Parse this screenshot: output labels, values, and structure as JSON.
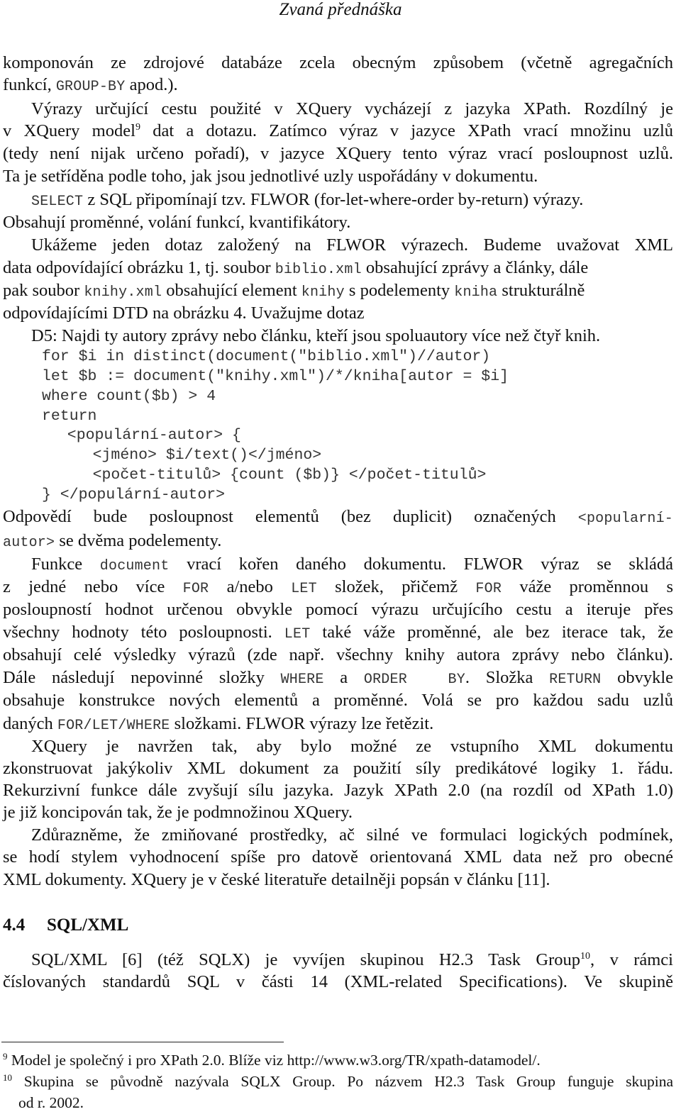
{
  "header": {
    "running_title": "Zvaná přednáška"
  },
  "paragraphs": {
    "p1": {
      "l1": "komponován ze zdrojové databáze zcela obecným způsobem (včetně agregačních",
      "l2_a": "funkcí,",
      "l2_code": "GROUP-BY",
      "l2_b": "apod.)."
    },
    "p2": {
      "l1": "Výrazy určující cestu použité v XQuery  vycházejí z jazyka XPath. Rozdílný je",
      "l2_a": "v XQuery model",
      "l2_fn": "9",
      "l2_b": " dat a dotazu. Zatímco výraz v jazyce XPath vrací množinu uzlů",
      "l3": "(tedy není nijak určeno pořadí), v jazyce XQuery tento výraz vrací posloupnost uzlů.",
      "l4": "Ta je setříděna podle toho, jak jsou jednotlivé uzly uspořádány v dokumentu."
    },
    "p3": {
      "l1_code": "SELECT",
      "l1_b": " z SQL připomínají tzv. FLWOR (for-let-where-order by-return) výrazy.",
      "l2": "Obsahují proměnné, volání funkcí, kvantifikátory."
    },
    "p4": {
      "l1": "Ukážeme jeden dotaz založený na FLWOR výrazech. Budeme uvažovat XML",
      "l2_a": "data odpovídající obrázku 1, tj. soubor ",
      "l2_code": "biblio.xml",
      "l2_b": " obsahující zprávy a články, dále",
      "l3_a": "pak soubor ",
      "l3_code1": "knihy.xml",
      "l3_b": " obsahující element ",
      "l3_code2": "knihy",
      "l3_c": " s podelementy ",
      "l3_code3": "kniha",
      "l3_d": " strukturálně",
      "l4": "odpovídajícími DTD na obrázku 4. Uvažujme dotaz"
    },
    "query_d5": "D5: Najdi ty autory zprávy nebo článku, kteří jsou spoluautory více než čtyř knih.",
    "code_lines": [
      "for $i in distinct(document(\"biblio.xml\")//autor)",
      "let $b := document(\"knihy.xml\")/*/kniha[autor = $i]",
      "where count($b) > 4",
      "return",
      "  <populární-autor> {",
      "    <jméno> $i/text()</jméno>",
      "    <počet-titulů> {count ($b)} </počet-titulů>",
      "} </populární-autor>"
    ],
    "p5": {
      "l1_a": "Odpovědí bude posloupnost elementů (bez duplicit) označených ",
      "l1_code": "<popularní-",
      "l2_code": "autor>",
      "l2_b": " se dvěma podelementy."
    },
    "p6": {
      "l1_a": "Funkce ",
      "l1_code": "document",
      "l1_b": " vrací kořen daného dokumentu.  FLWOR výraz se skládá",
      "l2_a": "z jedné nebo více ",
      "l2_code1": "FOR",
      "l2_b": " a/nebo ",
      "l2_code2": "LET",
      "l2_c": " složek, přičemž ",
      "l2_code3": "FOR",
      "l2_d": " váže proměnnou s",
      "l3": "posloupností hodnot určenou obvykle pomocí výrazu určujícího cestu a iteruje přes",
      "l4_a": "všechny hodnoty této posloupnosti. ",
      "l4_code": "LET",
      "l4_b": " také váže proměnné, ale bez iterace tak, že",
      "l5": "obsahují celé výsledky výrazů (zde např. všechny knihy autora zprávy nebo článku).",
      "l6_a": "Dále následují nepovinné složky ",
      "l6_code1": "WHERE",
      "l6_b": " a ",
      "l6_code2": "ORDER  BY",
      "l6_c": ". Složka ",
      "l6_code3": "RETURN",
      "l6_d": " obvykle",
      "l7": "obsahuje konstrukce nových elementů a proměnné. Volá se pro každou sadu uzlů",
      "l8_a": "daných ",
      "l8_code": "FOR/LET/WHERE",
      "l8_b": " složkami. FLWOR výrazy lze řetězit."
    },
    "p7": {
      "l1": "XQuery je navržen tak, aby bylo možné ze vstupního XML dokumentu",
      "l2": "zkonstruovat jakýkoliv XML dokument za použití síly predikátové logiky 1. řádu.",
      "l3": "Rekurzivní funkce dále zvyšují sílu jazyka. Jazyk XPath 2.0 (na rozdíl od XPath 1.0)",
      "l4": "je již koncipován tak, že je podmnožinou XQuery."
    },
    "p8": {
      "l1": "Zdůrazněme, že zmiňované prostředky, ač silné ve formulaci logických podmínek,",
      "l2": "se hodí stylem vyhodnocení spíše pro datově orientovaná XML data než pro obecné",
      "l3": "XML dokumenty.  XQuery je v české literatuře detailněji popsán v článku [11]."
    }
  },
  "section": {
    "number": "4.4",
    "title": "SQL/XML",
    "p1": {
      "l1_a": "SQL/XML [6] (též SQLX) je vyvíjen skupinou H2.3 Task Group",
      "l1_fn": "10",
      "l1_b": ", v rámci",
      "l2": "číslovaných standardů SQL v části 14 (XML-related Specifications). Ve skupině"
    }
  },
  "footnotes": [
    {
      "mark": "9",
      "text": " Model je společný i pro XPath 2.0. Blíže viz  http://www.w3.org/TR/xpath-datamodel/."
    },
    {
      "mark": "10",
      "text": " Skupina se původně nazývala SQLX Group. Po názvem H2.3 Task Group funguje skupina",
      "cont": "od r. 2002."
    }
  ]
}
